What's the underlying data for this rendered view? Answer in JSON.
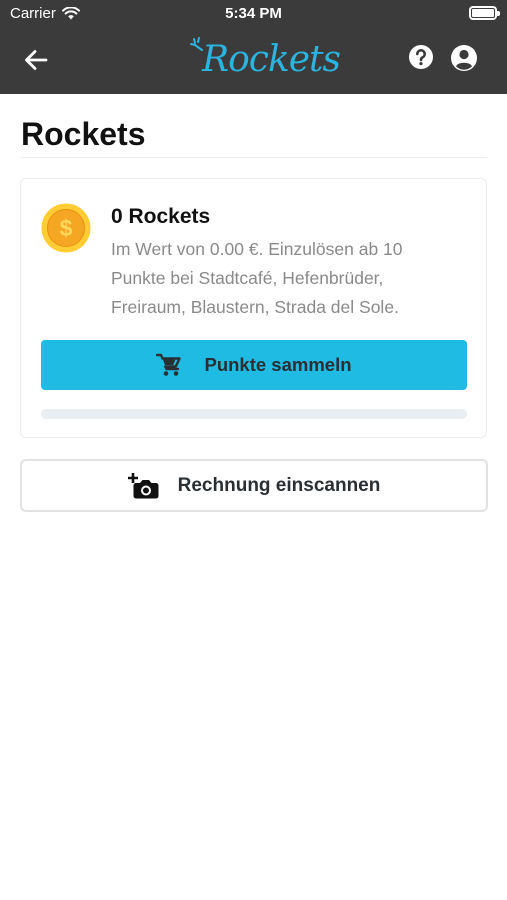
{
  "status_bar": {
    "carrier": "Carrier",
    "time": "5:34 PM",
    "wifi_icon": "wifi-icon",
    "battery_icon": "battery-icon"
  },
  "header": {
    "logo_text": "Rockets",
    "back_icon": "arrow-left-icon",
    "help_icon": "help-circle-icon",
    "account_icon": "account-circle-icon",
    "background_color": "#3b3b3b",
    "logo_color": "#2ab4df"
  },
  "page": {
    "title": "Rockets"
  },
  "rewards_card": {
    "coin_icon": "dollar-coin-icon",
    "heading": "0 Rockets",
    "description": "Im Wert von 0.00 €. Einzulösen ab 10 Punkte bei Stadtcafé, Hefenbrüder, Freiraum, Blaustern, Strada del Sole.",
    "collect_button": {
      "label": "Punkte sammeln",
      "icon": "cart-icon",
      "color": "#1fbbe3"
    },
    "progress": 0
  },
  "scan_button": {
    "label": "Rechnung einscannen",
    "icon": "camera-plus-icon"
  }
}
